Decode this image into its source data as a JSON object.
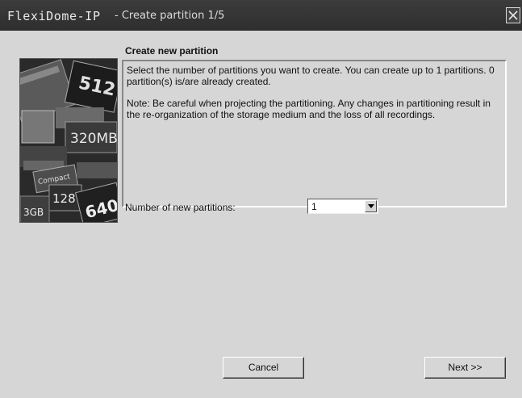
{
  "window": {
    "title_app": "FlexiDome-IP",
    "title_rest": "- Create partition 1/5",
    "close_icon": "close-icon"
  },
  "wizard": {
    "heading": "Create new partition",
    "info_text": "Select the number of partitions you want to create. You can create up to 1 partitions. 0 partition(s) is/are already created.",
    "note_text": "Note: Be careful when projecting the partitioning. Any changes in partitioning result in the re-organization of the storage medium and the loss of all recordings.",
    "image_labels": {
      "label_512": "512",
      "label_320": "320MB",
      "label_128": "128",
      "label_640": "640",
      "label_3gb": "3GB",
      "label_compact": "Compact"
    }
  },
  "partitions": {
    "label": "Number of new partitions:",
    "selected_value": "1"
  },
  "buttons": {
    "cancel_label": "Cancel",
    "next_label": "Next >>"
  }
}
